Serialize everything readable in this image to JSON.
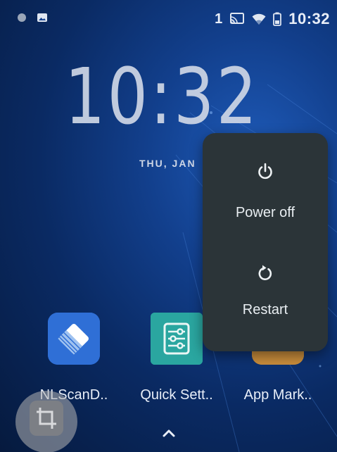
{
  "status_bar": {
    "notification_count": "1",
    "time": "10:32",
    "icons": [
      "circle-notification-icon",
      "image-notification-icon",
      "cast-icon",
      "wifi-icon",
      "battery-icon"
    ]
  },
  "lock_clock": {
    "time": "10:32",
    "date": "THU, JAN"
  },
  "power_menu": {
    "power_off_label": "Power off",
    "restart_label": "Restart",
    "icons": [
      "power-icon",
      "restart-icon"
    ]
  },
  "apps": [
    {
      "label": "NLScanD..",
      "icon": "nlscan-app-icon"
    },
    {
      "label": "Quick Sett..",
      "icon": "quick-settings-app-icon"
    },
    {
      "label": "App Mark..",
      "icon": "app-market-icon"
    }
  ],
  "colors": {
    "menu_background": "#2b3438",
    "wallpaper_primary": "#123f8c",
    "text_primary": "#e9eef2"
  }
}
